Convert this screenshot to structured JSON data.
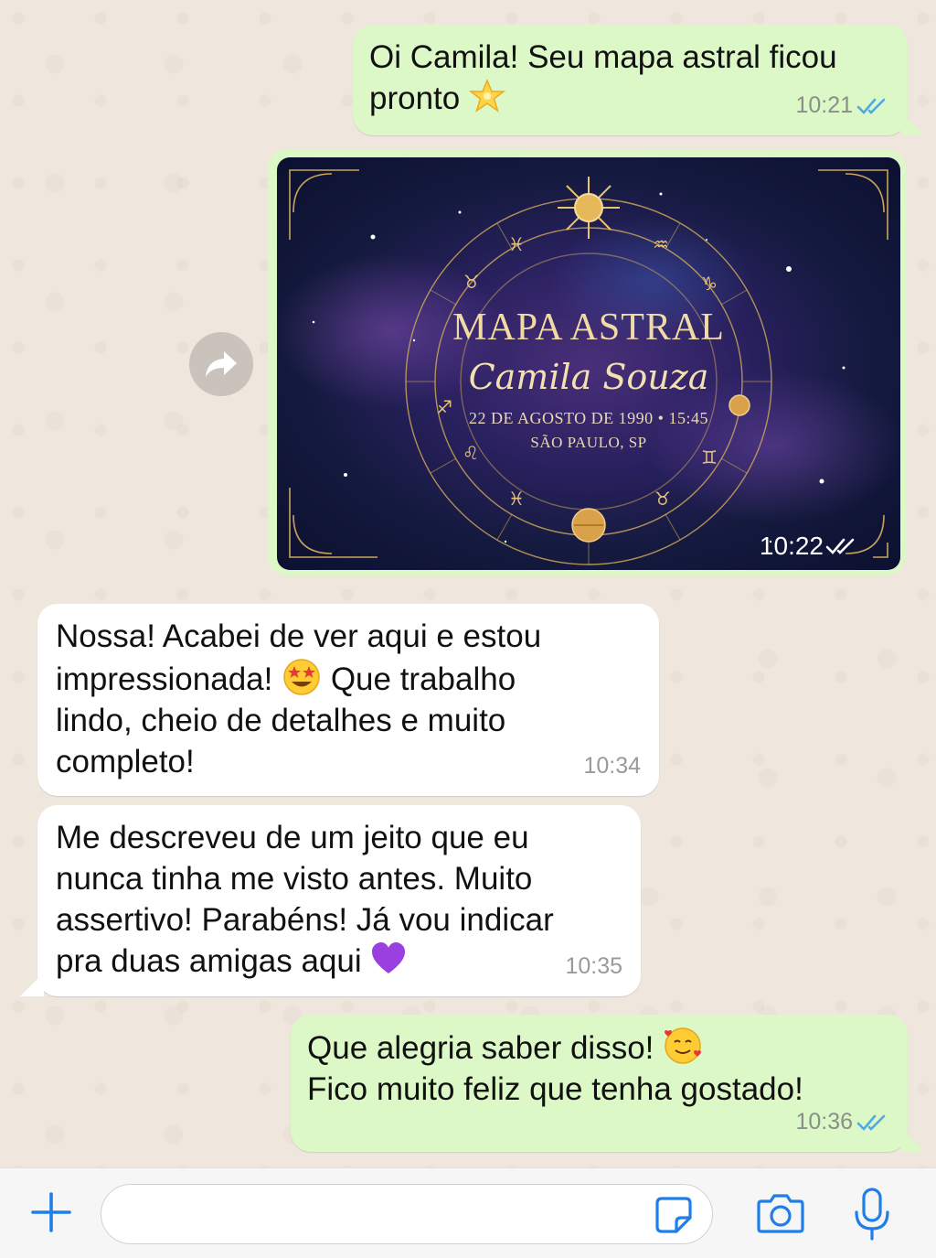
{
  "messages": [
    {
      "id": "m1",
      "direction": "outgoing",
      "text": "Oi Camila! Seu mapa astral ficou\npronto",
      "emoji": "glowing-star",
      "time": "10:21",
      "status": "read"
    },
    {
      "id": "m2",
      "direction": "outgoing",
      "type": "image",
      "time": "10:22",
      "status": "read",
      "image": {
        "title": "MAPA ASTRAL",
        "name": "Camila Souza",
        "date_line": "22 DE AGOSTO DE 1990 • 15:45",
        "place_line": "SÃO PAULO, SP"
      }
    },
    {
      "id": "m3",
      "direction": "incoming",
      "text_a": "Nossa! Acabei de ver aqui e estou\nimpressionada!",
      "emoji": "star-struck",
      "text_b": "Que trabalho\nlindo, cheio de detalhes e muito\ncompleto!",
      "time": "10:34"
    },
    {
      "id": "m4",
      "direction": "incoming",
      "text": "Me descreveu de um jeito que eu\nnunca tinha me visto antes. Muito\nassertivo! Parabéns! Já vou indicar\npra duas amigas aqui",
      "emoji": "purple-heart",
      "time": "10:35"
    },
    {
      "id": "m5",
      "direction": "outgoing",
      "text_a": "Que alegria saber disso!",
      "emoji": "smiling-face-with-hearts",
      "text_b": "Fico muito feliz que tenha gostado!",
      "time": "10:36",
      "status": "read"
    }
  ],
  "input_bar": {
    "placeholder": ""
  },
  "colors": {
    "outgoing": "#dbf8c6",
    "incoming": "#ffffff",
    "background": "#efe7de",
    "accent": "#1f7ee8",
    "read_ticks": "#4fa8e8"
  },
  "icons": [
    "plus-icon",
    "sticker-icon",
    "camera-icon",
    "microphone-icon",
    "forward-icon",
    "double-check-icon"
  ]
}
